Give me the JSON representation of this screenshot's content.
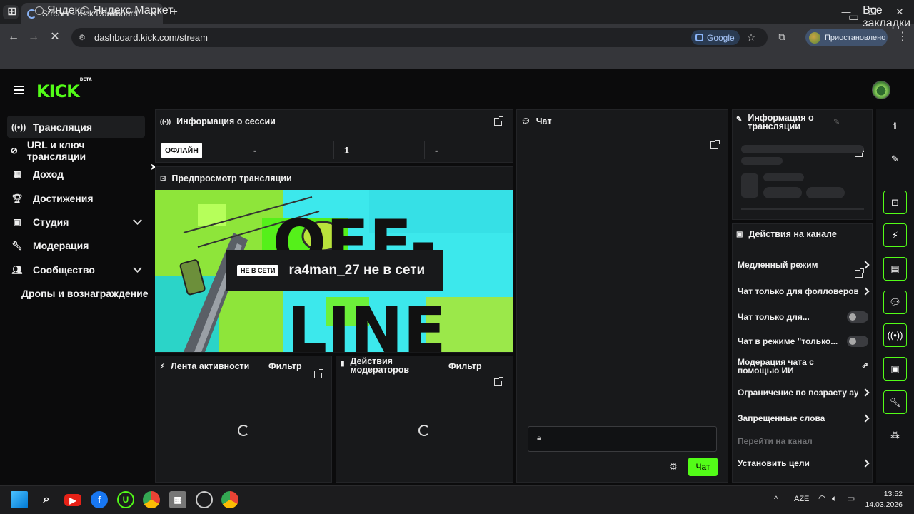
{
  "browser": {
    "tab_title": "Stream - Kick Dashboard",
    "url": "dashboard.kick.com/stream",
    "google_pill": "Google",
    "profile_status": "Приостановлено",
    "bookmarks": [
      "Яндекс",
      "Яндекс Маркет"
    ],
    "all_bookmarks": "Все закладки"
  },
  "app": {
    "logo": "KICK",
    "logo_badge": "BETA"
  },
  "sidebar": {
    "items": [
      {
        "label": "Трансляция",
        "icon": "broadcast-icon"
      },
      {
        "label": "URL и ключ трансляции",
        "icon": "link-icon"
      },
      {
        "label": "Доход",
        "icon": "chart-icon"
      },
      {
        "label": "Достижения",
        "icon": "trophy-icon"
      },
      {
        "label": "Студия",
        "icon": "studio-icon"
      },
      {
        "label": "Модерация",
        "icon": "wrench-icon"
      },
      {
        "label": "Сообщество",
        "icon": "people-icon"
      },
      {
        "label": "Дропы и вознаграждение",
        "icon": ""
      }
    ]
  },
  "session": {
    "title": "Информация о сессии",
    "status": "ОФЛАЙН",
    "stats": [
      "-",
      "1",
      "-"
    ]
  },
  "preview": {
    "title": "Предпросмотр трансляции",
    "badge": "НЕ В СЕТИ",
    "offline_text": "ra4man_27 не в сети",
    "art_text": "OFF-LINE"
  },
  "activity": {
    "title": "Лента активности",
    "filter": "Фильтр"
  },
  "modactions": {
    "title": "Действия модераторов",
    "filter": "Фильтр"
  },
  "chat": {
    "title": "Чат",
    "send": "Чат"
  },
  "streaminfo": {
    "title": "Информация о трансляции"
  },
  "channel_actions": {
    "title": "Действия на канале",
    "items": [
      {
        "label": "Медленный режим",
        "control": "arrow"
      },
      {
        "label": "Чат только для фолловеров",
        "control": "arrow"
      },
      {
        "label": "Чат только для...",
        "control": "toggle",
        "on": false
      },
      {
        "label": "Чат в режиме \"только...",
        "control": "toggle",
        "on": false
      },
      {
        "label": "Модерация чата с помощью ИИ",
        "control": "external"
      },
      {
        "label": "Ограничение по возрасту аудитории",
        "control": "arrow"
      },
      {
        "label": "Запрещенные слова",
        "control": "arrow"
      },
      {
        "label": "Перейти на канал",
        "control": "none"
      },
      {
        "label": "Установить цели",
        "control": "arrow"
      }
    ]
  },
  "taskbar": {
    "lang": "AZE",
    "time": "13:52",
    "date": "14.03.2026"
  },
  "colors": {
    "accent": "#53fc18",
    "panel": "#18191b",
    "bg": "#0b0b0c"
  }
}
